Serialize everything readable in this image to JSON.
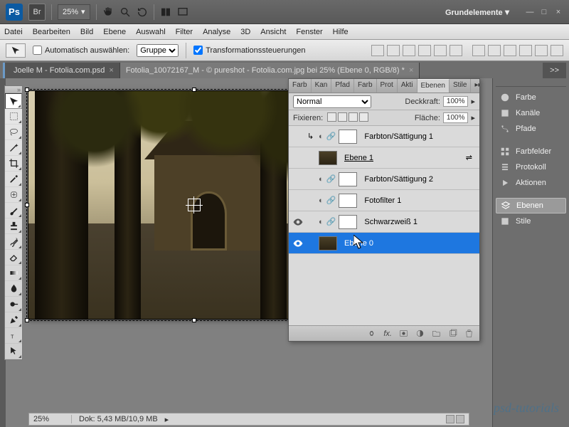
{
  "app": {
    "shortname": "Ps",
    "bridge": "Br",
    "zoom": "25%",
    "workspace": "Grundelemente"
  },
  "menubar": [
    "Datei",
    "Bearbeiten",
    "Bild",
    "Ebene",
    "Auswahl",
    "Filter",
    "Analyse",
    "3D",
    "Ansicht",
    "Fenster",
    "Hilfe"
  ],
  "options": {
    "auto_select": "Automatisch auswählen:",
    "group": "Gruppe",
    "transform": "Transformationssteuerungen"
  },
  "tabs": {
    "t1": "Joelle M - Fotolia.com.psd",
    "t2": "Fotolia_10072167_M - © pureshot - Fotolia.com.jpg bei 25% (Ebene 0, RGB/8) *",
    "more": ">>"
  },
  "rightPanels": [
    "Farbe",
    "Kanäle",
    "Pfade",
    "Farbfelder",
    "Protokoll",
    "Aktionen",
    "Ebenen",
    "Stile"
  ],
  "layersPanel": {
    "tabs": [
      "Farb",
      "Kan",
      "Pfad",
      "Farb",
      "Prot",
      "Akti",
      "Ebenen",
      "Stile"
    ],
    "blend": "Normal",
    "opacityLabel": "Deckkraft:",
    "opacity": "100%",
    "lockLabel": "Fixieren:",
    "fillLabel": "Fläche:",
    "fill": "100%",
    "layers": [
      {
        "name": "Farbton/Sättigung 1",
        "type": "adj",
        "visible": false
      },
      {
        "name": "Ebene 1",
        "type": "image",
        "visible": false,
        "underline": true
      },
      {
        "name": "Farbton/Sättigung 2",
        "type": "adj",
        "visible": false
      },
      {
        "name": "Fotofilter 1",
        "type": "adj",
        "visible": false
      },
      {
        "name": "Schwarzweiß 1",
        "type": "adj",
        "visible": true
      },
      {
        "name": "Ebene 0",
        "type": "image",
        "visible": true,
        "selected": true
      }
    ]
  },
  "status": {
    "zoom": "25%",
    "doc": "Dok: 5,43 MB/10,9 MB"
  },
  "watermark": "psd-tutorials"
}
